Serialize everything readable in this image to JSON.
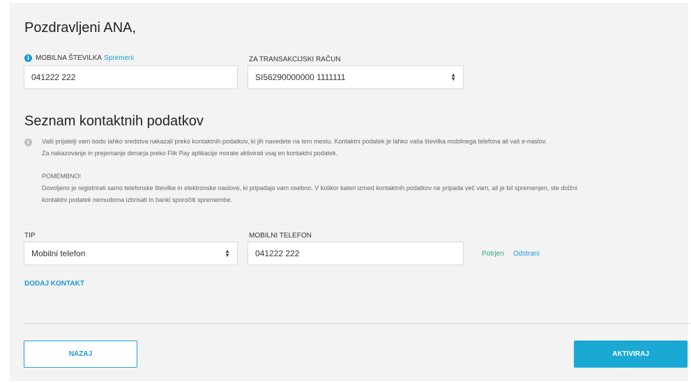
{
  "greeting": "Pozdravljeni ANA,",
  "mobile": {
    "label": "MOBILNA ŠTEVILKA",
    "change_link": "Spremeni",
    "value": "041222 222"
  },
  "account": {
    "label": "ZA TRANSAKCIJSKI RAČUN",
    "value": "SI56290000000 1111111"
  },
  "contacts": {
    "title": "Seznam kontaktnih podatkov",
    "info_line1": "Vaši prijatelji vam bodo lahko sredstva nakazali preko kontaktnih podatkov, ki jih navedete na tem mestu. Kontaktni podatek je lahko vaša številka mobilnega telefona ali vaš e-naslov.",
    "info_line2": "Za nakazovanje in prejemanje denarja preko Flik Pay aplikacije morate aktivirati vsaj en kontaktni podatek.",
    "important_title": "POMEMBNO!",
    "important_line1": "Dovoljeno je registrirati samo telefonske številke in elektronske naslove, ki pripadajo vam osebno. V kolikor kateri izmed kontaktnih podatkov ne pripada več vam, ali je bil spremenjen, ste dolžni",
    "important_line2": "kontaktni podatek nemudoma izbrisati in banki sporočiti spremembe.",
    "type_label": "TIP",
    "type_value": "Mobilni telefon",
    "phone_label": "MOBILNI TELEFON",
    "phone_value": "041222 222",
    "confirmed": "Potrjen",
    "remove": "Odstrani",
    "add_contact": "DODAJ KONTAKT"
  },
  "buttons": {
    "back": "NAZAJ",
    "activate": "AKTIVIRAJ"
  },
  "colors": {
    "accent": "#1aa9d4",
    "link": "#1a9ad6",
    "confirmed": "#2aa876",
    "panel_bg": "#f3f3f3"
  }
}
